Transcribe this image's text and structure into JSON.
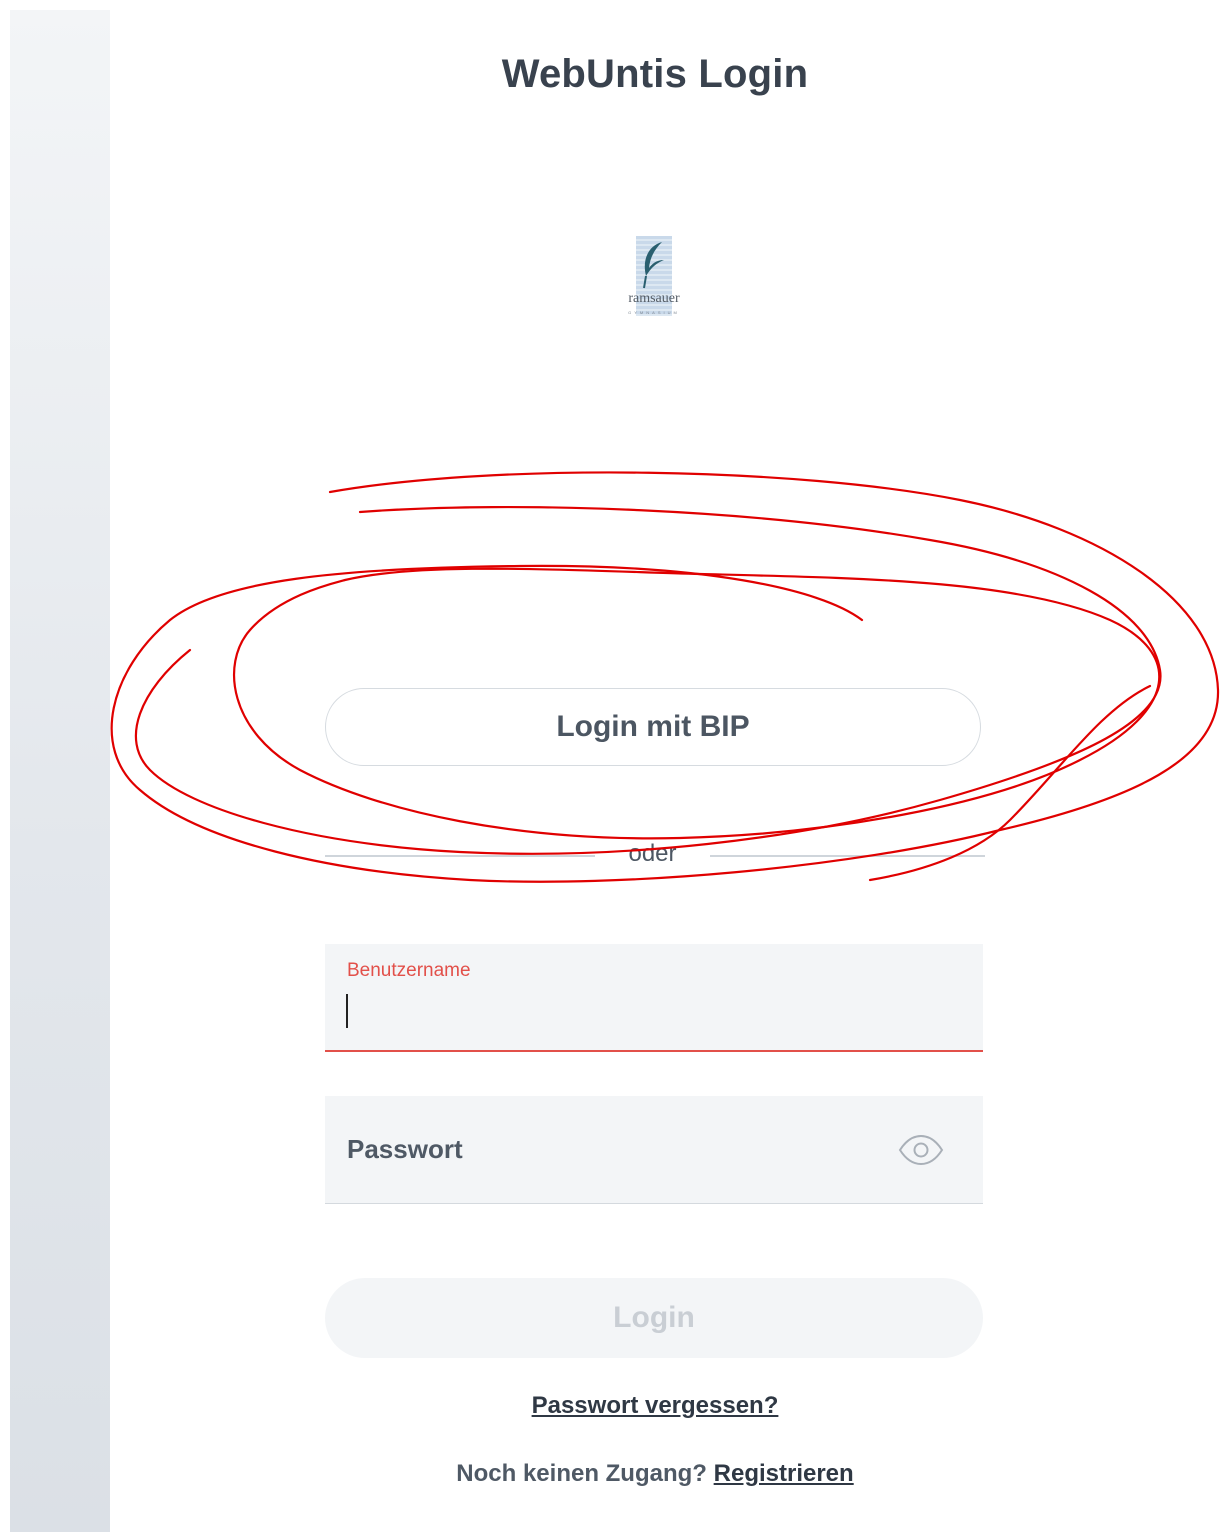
{
  "app": {
    "title": "WebUntis Login"
  },
  "school_logo": {
    "wordmark": "ramsauer",
    "subtext": "GYMNASIUM"
  },
  "sso": {
    "button_label": "Login mit BIP"
  },
  "divider": {
    "label": "oder"
  },
  "username": {
    "label": "Benutzername",
    "value": ""
  },
  "password": {
    "label": "Passwort",
    "value": ""
  },
  "login": {
    "button_label": "Login"
  },
  "links": {
    "forgot_password": "Passwort vergessen?",
    "no_account_prompt": "Noch keinen Zugang?",
    "register": "Registrieren"
  },
  "colors": {
    "accent_error": "#e2504a",
    "annotation_stroke": "#e00000",
    "field_background": "#f3f5f7"
  }
}
